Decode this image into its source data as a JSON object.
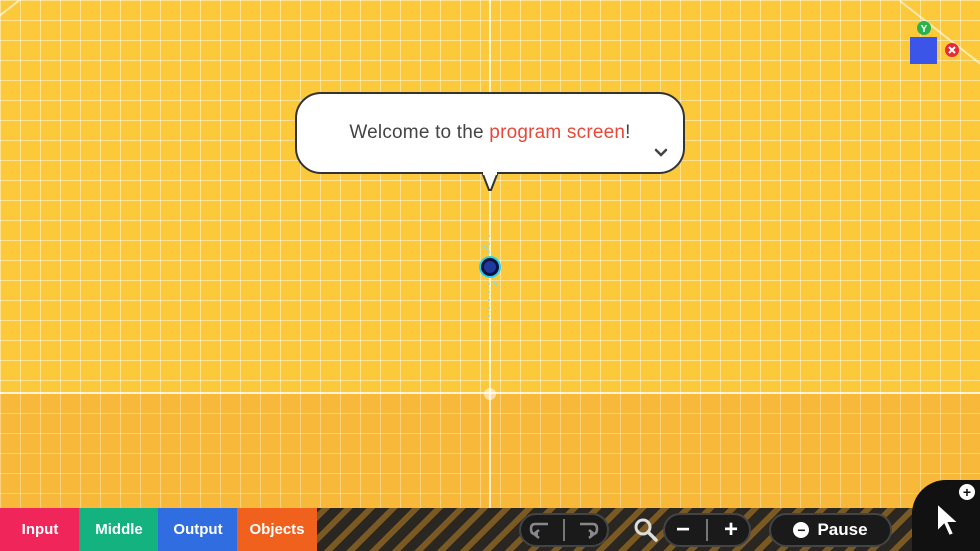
{
  "bubble": {
    "text_before": "Welcome to the ",
    "highlight": "program screen",
    "text_after": "!"
  },
  "gizmo": {
    "axis_label": "Y"
  },
  "tabs": [
    {
      "label": "Input",
      "color": "#f0255a"
    },
    {
      "label": "Middle",
      "color": "#13b27f"
    },
    {
      "label": "Output",
      "color": "#2f6de0"
    },
    {
      "label": "Objects",
      "color": "#f0611e"
    }
  ],
  "controls": {
    "undo_icon": "undo-icon",
    "redo_icon": "redo-icon",
    "zoom_icon": "magnifier-icon",
    "zoom_out": "−",
    "zoom_in": "+",
    "pause_label": "Pause",
    "pause_glyph": "−"
  },
  "corner": {
    "plus_glyph": "+"
  },
  "colors": {
    "background": "#fbc93a",
    "highlight": "#e8483a"
  }
}
